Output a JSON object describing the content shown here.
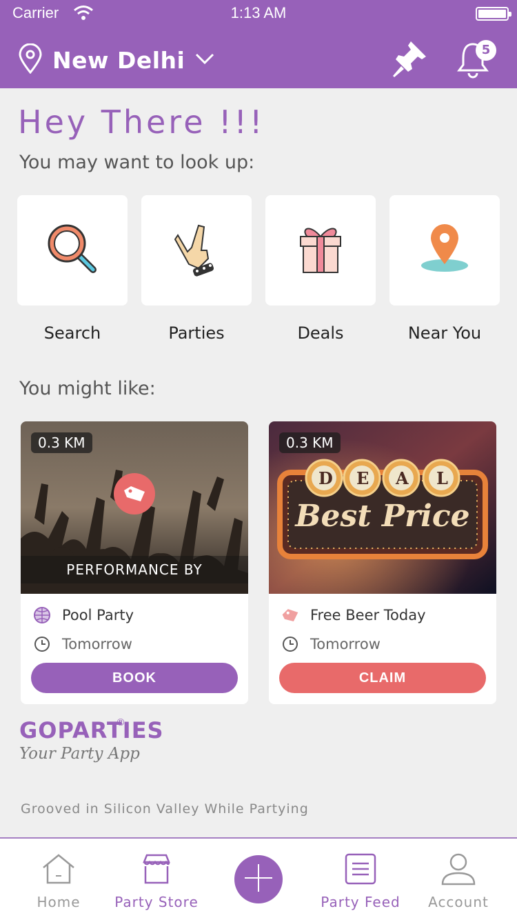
{
  "status_bar": {
    "carrier": "Carrier",
    "time": "1:13 AM"
  },
  "header": {
    "city": "New Delhi",
    "notification_count": "5"
  },
  "greeting": {
    "title": "Hey There !!!",
    "subtitle": "You may want to look up:"
  },
  "quick_links": [
    {
      "label": "Search",
      "icon": "magnifier-icon"
    },
    {
      "label": "Parties",
      "icon": "rock-hand-icon"
    },
    {
      "label": "Deals",
      "icon": "gift-icon"
    },
    {
      "label": "Near You",
      "icon": "map-pin-icon"
    }
  ],
  "recommend_title": "You might like:",
  "cards": [
    {
      "distance": "0.3 KM",
      "overlay": "PERFORMANCE BY",
      "name": "Pool Party",
      "when": "Tomorrow",
      "action": "BOOK",
      "action_color": "#9761b9"
    },
    {
      "distance": "0.3 KM",
      "name": "Free Beer Today",
      "when": "Tomorrow",
      "action": "CLAIM",
      "action_color": "#e86a6a",
      "sign_letters": [
        "D",
        "E",
        "A",
        "L"
      ],
      "sign_text": "Best Price"
    }
  ],
  "brand": {
    "name": "GOPARTIES",
    "reg": "®",
    "tagline": "Your Party App",
    "footer": "Grooved in Silicon Valley While Partying"
  },
  "tabs": [
    {
      "label": "Home",
      "active": false
    },
    {
      "label": "Party Store",
      "active": true
    },
    {
      "label": "Party Feed",
      "active": true
    },
    {
      "label": "Account",
      "active": false
    }
  ],
  "colors": {
    "primary": "#9761b9",
    "accent": "#e86a6a",
    "background": "#efefef"
  }
}
